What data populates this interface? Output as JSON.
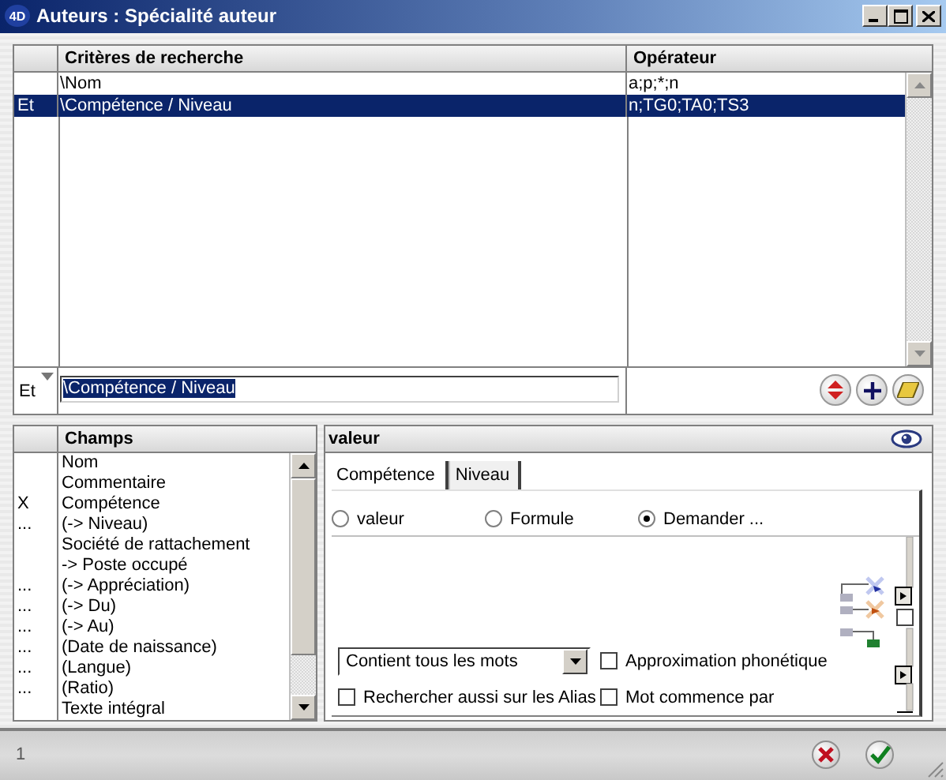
{
  "window": {
    "logo": "4D",
    "title": "Auteurs : Spécialité auteur"
  },
  "criteria_table": {
    "columns": [
      "Critères de recherche",
      "Opérateur"
    ],
    "rows": [
      {
        "criterion": "\\Nom",
        "operator": "a;p;*;n",
        "selected": false
      },
      {
        "conjunction": "Et",
        "criterion": "\\Compétence / Niveau",
        "operator": "n;TG0;TA0;TS3",
        "selected": true
      }
    ],
    "edit_row": {
      "conjunction": "Et",
      "value": "\\Compétence / Niveau"
    }
  },
  "fields_list": {
    "header": "Champs",
    "items": [
      {
        "name": "Nom"
      },
      {
        "name": "Commentaire"
      },
      {
        "mark": "X",
        "name": "Compétence"
      },
      {
        "mark": "...",
        "name": "(-> Niveau)"
      },
      {
        "name": "Société de rattachement"
      },
      {
        "name": "-> Poste occupé"
      },
      {
        "mark": "...",
        "name": "(-> Appréciation)"
      },
      {
        "mark": "...",
        "name": "(-> Du)"
      },
      {
        "mark": "...",
        "name": "(-> Au)"
      },
      {
        "mark": "...",
        "name": "(Date de naissance)"
      },
      {
        "mark": "...",
        "name": "(Langue)"
      },
      {
        "mark": "...",
        "name": "(Ratio)"
      },
      {
        "name": "Texte intégral"
      }
    ]
  },
  "value_panel": {
    "header": "valeur",
    "tabs": [
      {
        "label": "Compétence",
        "selected": true
      },
      {
        "label": "Niveau",
        "selected": false
      }
    ],
    "radios": [
      {
        "label": "valeur",
        "selected": false
      },
      {
        "label": "Formule",
        "selected": false
      },
      {
        "label": "Demander ...",
        "selected": true
      }
    ],
    "dropdown": {
      "value": "Contient tous les mots"
    },
    "checkboxes": [
      {
        "label": "Approximation phonétique",
        "checked": false
      },
      {
        "label": "Rechercher aussi sur les Alias",
        "checked": false
      },
      {
        "label": "Mot commence par",
        "checked": false
      }
    ]
  },
  "status_bar": {
    "record_count": "1"
  }
}
